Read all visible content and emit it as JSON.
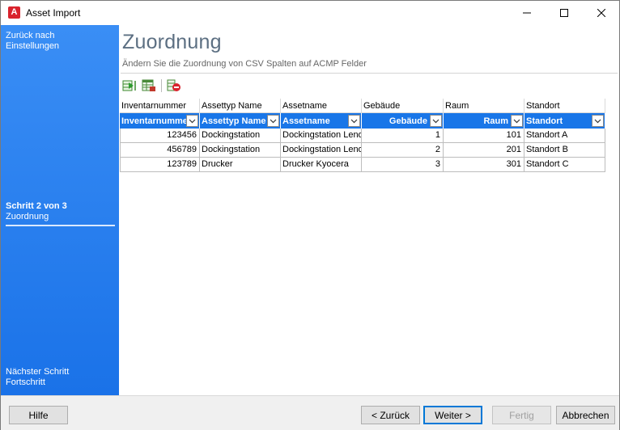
{
  "window": {
    "title": "Asset Import",
    "icon_letter": "A",
    "icon_color": "#d9232d"
  },
  "sidebar": {
    "back_line1": "Zurück nach",
    "back_line2": "Einstellungen",
    "step_line1": "Schritt 2 von 3",
    "step_line2": "Zuordnung",
    "next_line1": "Nächster Schritt",
    "next_line2": "Fortschritt",
    "color": "#1a72e8"
  },
  "main": {
    "title": "Zuordnung",
    "subtitle": "Ändern Sie die Zuordnung von CSV Spalten auf ACMP Felder"
  },
  "toolbar": {
    "icons": [
      "add-mapping-icon",
      "table-mapping-icon",
      "remove-mapping-icon"
    ]
  },
  "grid": {
    "csv_headers": [
      "Inventarnummer",
      "Assettyp Name",
      "Assetname",
      "Gebäude",
      "Raum",
      "Standort"
    ],
    "mapped_fields": [
      "Inventarnummer",
      "Assettyp Name",
      "Assetname",
      "Gebäude",
      "Raum",
      "Standort"
    ],
    "rows": [
      [
        "123456",
        "Dockingstation",
        "Dockingstation Lenovo",
        "1",
        "101",
        "Standort A"
      ],
      [
        "456789",
        "Dockingstation",
        "Dockingstation Lenovo",
        "2",
        "201",
        "Standort B"
      ],
      [
        "123789",
        "Drucker",
        "Drucker Kyocera",
        "3",
        "301",
        "Standort C"
      ]
    ],
    "header_color": "#1976e8"
  },
  "footer": {
    "help": "Hilfe",
    "back": "< Zurück",
    "next": "Weiter >",
    "finish": "Fertig",
    "cancel": "Abbrechen"
  }
}
